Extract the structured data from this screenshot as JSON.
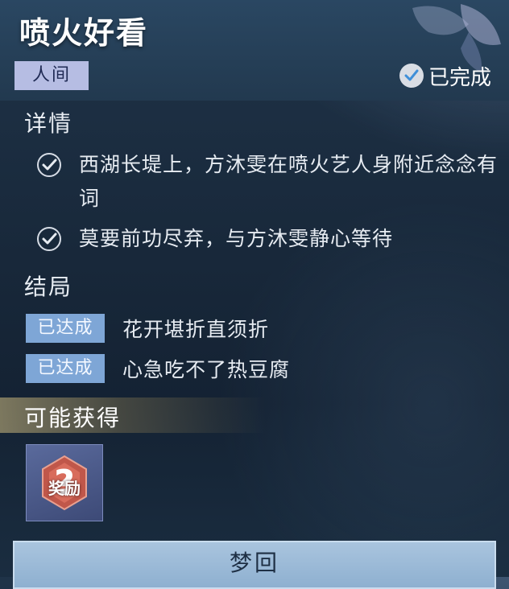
{
  "quest": {
    "title": "喷火好看",
    "tag": "人间",
    "status": "已完成"
  },
  "details": {
    "heading": "详情",
    "items": [
      {
        "text": "西湖长堤上，方沐雯在喷火艺人身附近念念有词"
      },
      {
        "text": "莫要前功尽弃，与方沐雯静心等待"
      }
    ]
  },
  "endings": {
    "heading": "结局",
    "items": [
      {
        "badge": "已达成",
        "text": "花开堪折直须折"
      },
      {
        "badge": "已达成",
        "text": "心急吃不了热豆腐"
      }
    ]
  },
  "rewards": {
    "heading": "可能获得",
    "item_label": "奖励"
  },
  "action": {
    "label": "梦回"
  }
}
